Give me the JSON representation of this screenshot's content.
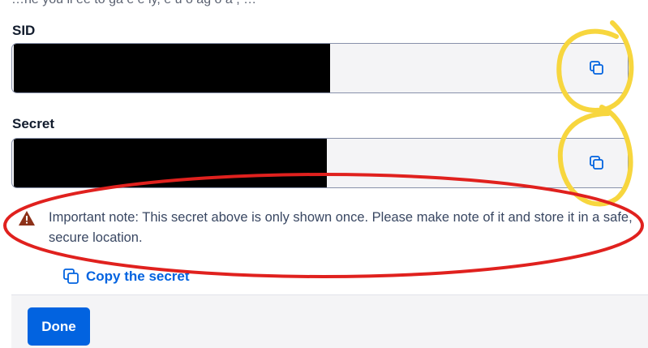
{
  "header": {
    "cut_text": "…ne     you   ll   ee  to    ga   e  e  ly,   e   u     o  ag   o  a   , …"
  },
  "sid": {
    "label": "SID"
  },
  "secret": {
    "label": "Secret"
  },
  "note": {
    "icon": "warning-triangle-icon",
    "text": "Important note: This secret above is only shown once. Please make note of it and store it in a safe, secure location."
  },
  "copy_secret": {
    "label": "Copy the secret",
    "icon": "copy-icon"
  },
  "footer": {
    "done_label": "Done"
  },
  "colors": {
    "accent": "#0263e0",
    "warning": "#8d3118",
    "field_bg": "#f4f4f6",
    "annotation_yellow": "#f7d63e",
    "annotation_red": "#e0211e",
    "redaction": "#000000"
  }
}
